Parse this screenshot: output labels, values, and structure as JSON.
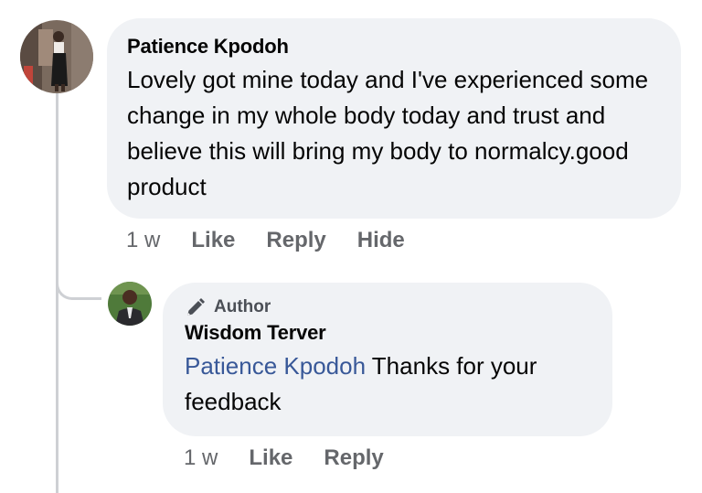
{
  "main_comment": {
    "author": "Patience Kpodoh",
    "text": "Lovely got mine today and I've experienced some change in my whole body today and trust and believe this will bring my body to normalcy.good product",
    "time": "1 w",
    "actions": {
      "like": "Like",
      "reply": "Reply",
      "hide": "Hide"
    }
  },
  "reply_comment": {
    "badge": "Author",
    "author": "Wisdom Terver",
    "mention": "Patience Kpodoh",
    "text": " Thanks for your feedback",
    "time": "1 w",
    "actions": {
      "like": "Like",
      "reply": "Reply"
    }
  },
  "icons": {
    "badge_icon": "pencil-icon"
  },
  "colors": {
    "bubble": "#f0f2f5",
    "meta_text": "#65676b",
    "mention": "#385898",
    "thread_line": "#ced0d4"
  }
}
